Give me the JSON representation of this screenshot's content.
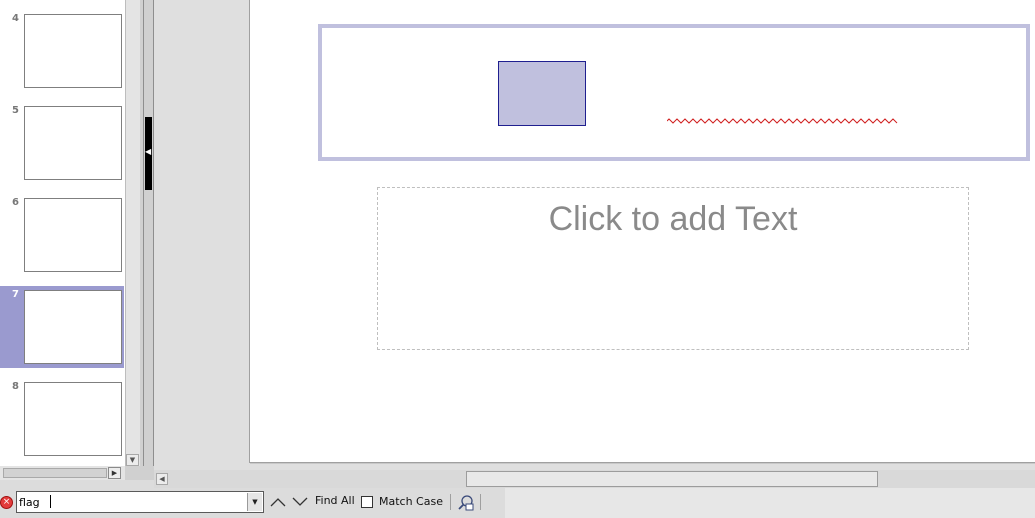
{
  "slide_pane": {
    "slides": [
      {
        "number": "4",
        "selected": false
      },
      {
        "number": "5",
        "selected": false
      },
      {
        "number": "6",
        "selected": false
      },
      {
        "number": "7",
        "selected": true
      },
      {
        "number": "8",
        "selected": false
      }
    ]
  },
  "slide": {
    "content_placeholder": "Click to add Text"
  },
  "find_toolbar": {
    "search_value": "flag",
    "find_all_label": "Find All",
    "match_case_label": "Match Case",
    "match_case_checked": false
  },
  "icons": {
    "close": "close-find-icon",
    "previous": "chevron-up-icon",
    "next": "chevron-down-icon",
    "find_replace": "find-replace-icon"
  },
  "colors": {
    "selection": "#9a9acf",
    "title_frame": "#c0c0de",
    "shape_border": "#1f1f8f",
    "spellcheck": "#d02020",
    "placeholder_text": "#8a8a8a"
  }
}
